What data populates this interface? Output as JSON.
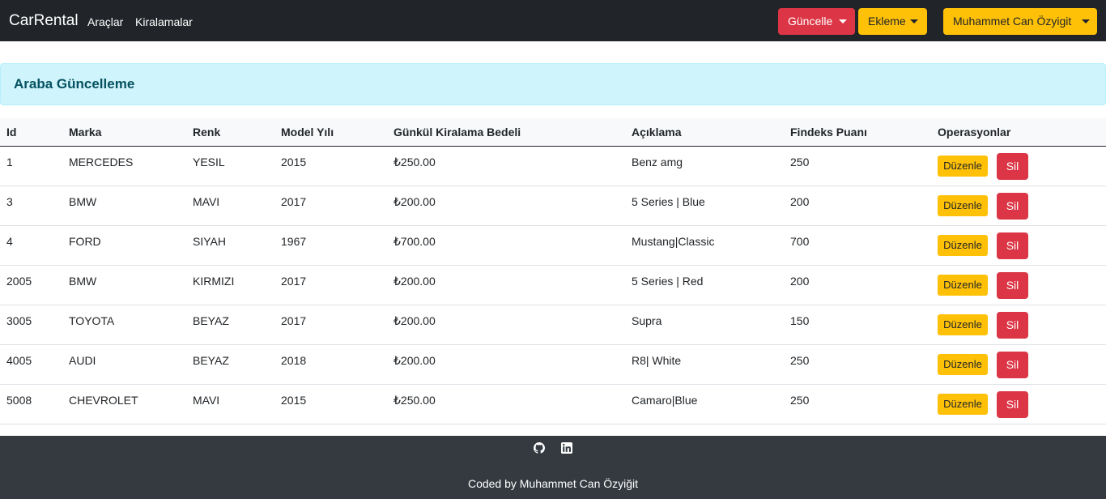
{
  "navbar": {
    "brand": "CarRental",
    "links": [
      "Araçlar",
      "Kiralamalar"
    ],
    "update_dropdown": "Güncelle",
    "add_dropdown": "Ekleme",
    "user_dropdown": "Muhammet Can Özyigit"
  },
  "alert": {
    "title": "Araba Güncelleme"
  },
  "table": {
    "headers": [
      "Id",
      "Marka",
      "Renk",
      "Model Yılı",
      "Günkül Kiralama Bedeli",
      "Açıklama",
      "Findeks Puanı",
      "Operasyonlar"
    ],
    "edit_label": "Düzenle",
    "delete_label": "Sil",
    "rows": [
      [
        "1",
        "MERCEDES",
        "YESIL",
        "2015",
        "₺250.00",
        "Benz amg",
        "250"
      ],
      [
        "3",
        "BMW",
        "MAVI",
        "2017",
        "₺200.00",
        "5 Series | Blue",
        "200"
      ],
      [
        "4",
        "FORD",
        "SIYAH",
        "1967",
        "₺700.00",
        "Mustang|Classic",
        "700"
      ],
      [
        "2005",
        "BMW",
        "KIRMIZI",
        "2017",
        "₺200.00",
        "5 Series | Red",
        "200"
      ],
      [
        "3005",
        "TOYOTA",
        "BEYAZ",
        "2017",
        "₺200.00",
        "Supra",
        "150"
      ],
      [
        "4005",
        "AUDI",
        "BEYAZ",
        "2018",
        "₺200.00",
        "R8| White",
        "250"
      ],
      [
        "5008",
        "CHEVROLET",
        "MAVI",
        "2015",
        "₺250.00",
        "Camaro|Blue",
        "250"
      ]
    ]
  },
  "footer": {
    "icons": [
      "github-icon",
      "linkedin-icon"
    ],
    "text": "Coded by Muhammet Can Özyiğit"
  },
  "colors": {
    "navbar_bg": "#212529",
    "danger": "#dc3545",
    "warning": "#ffc107",
    "alert_bg": "#cff4fc",
    "alert_text": "#055160",
    "footer_bg": "#343a40"
  }
}
